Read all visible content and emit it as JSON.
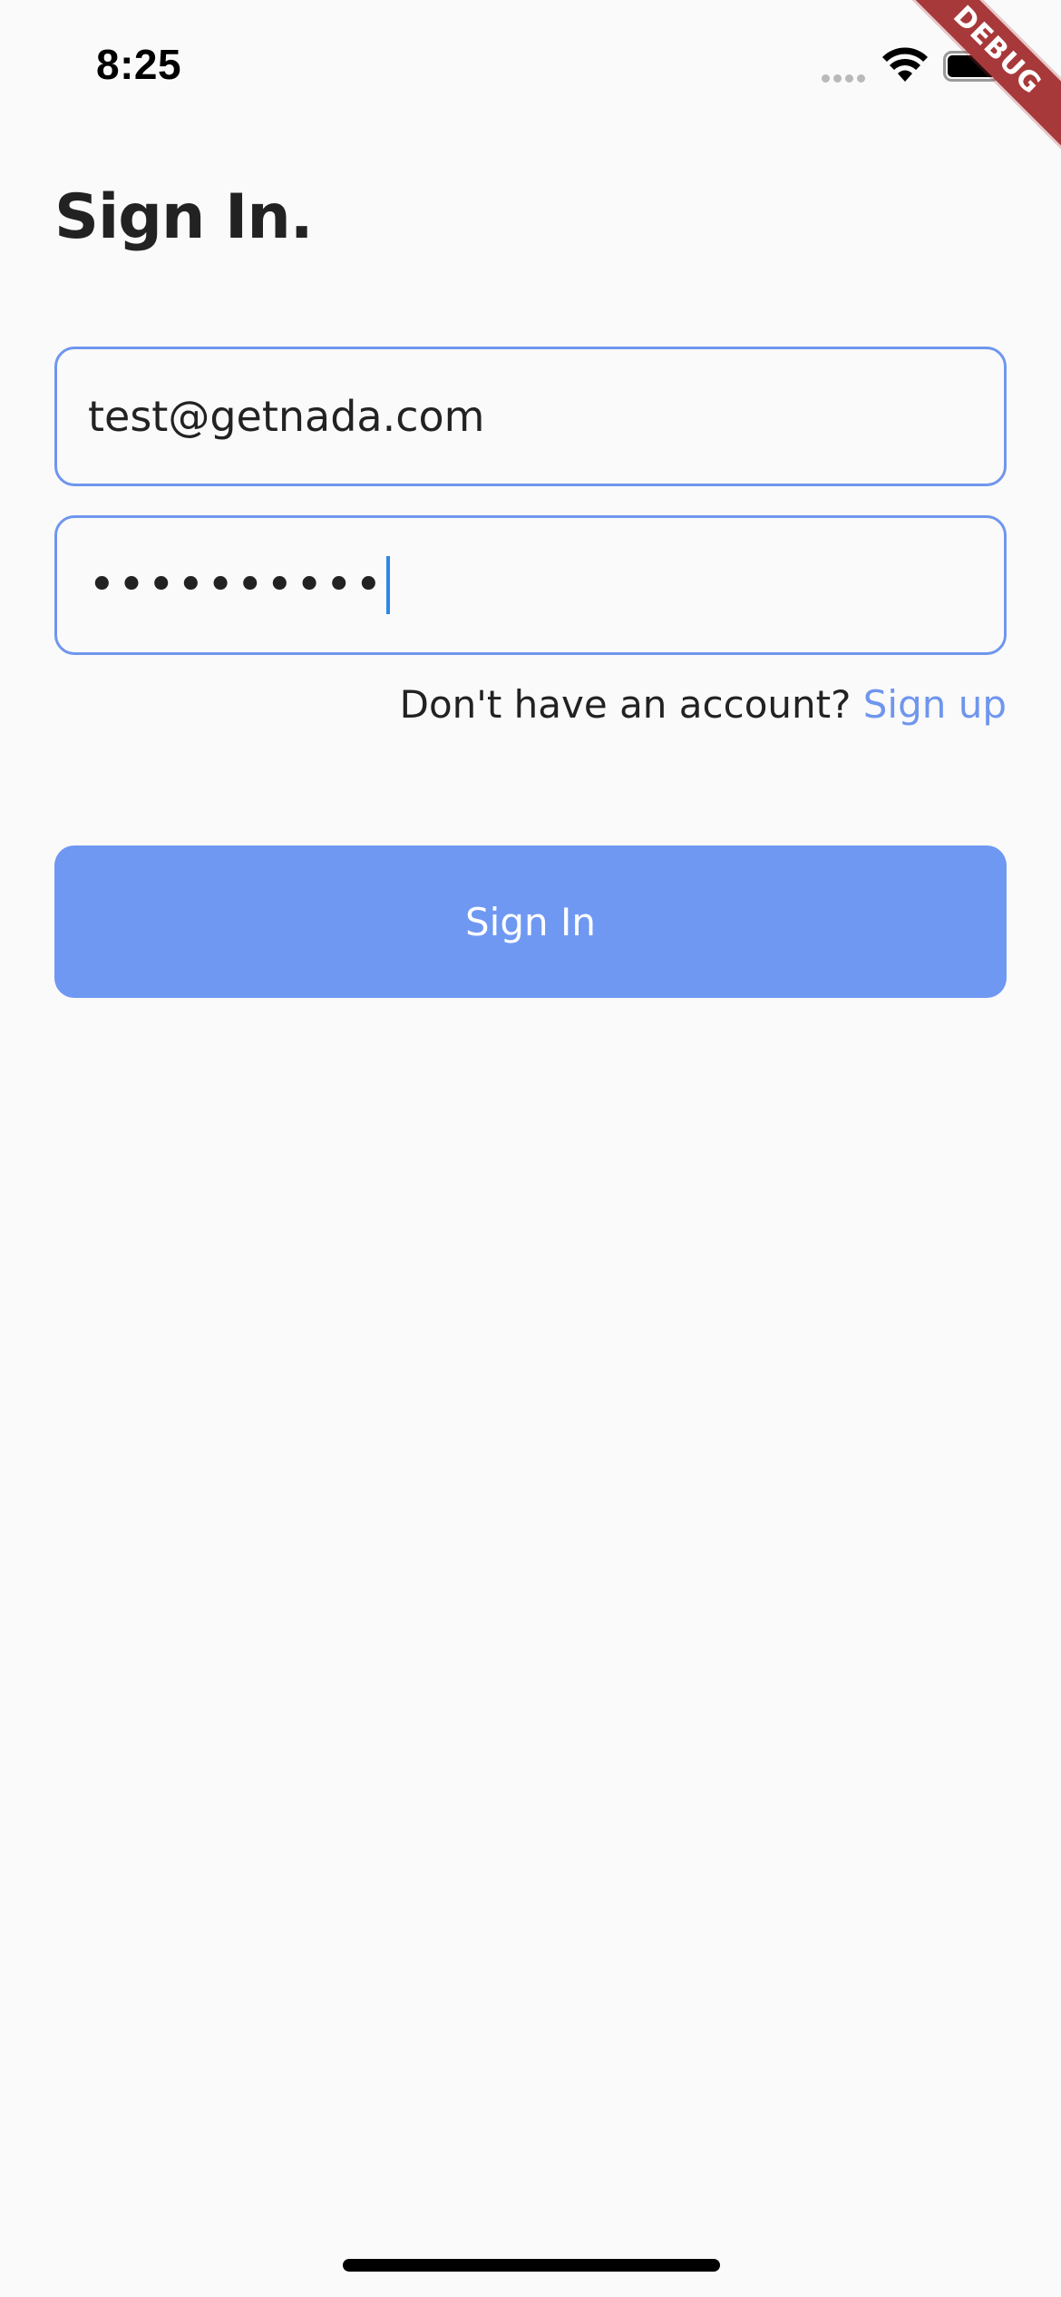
{
  "status_bar": {
    "time": "8:25"
  },
  "debug_ribbon": {
    "label": "DEBUG"
  },
  "page": {
    "title": "Sign In."
  },
  "form": {
    "email": {
      "value": "test@getnada.com",
      "placeholder": ""
    },
    "password": {
      "masked_value": "••••••••••"
    }
  },
  "signup": {
    "prompt": "Don't have an account?",
    "link_label": "Sign up"
  },
  "actions": {
    "signin_label": "Sign In"
  },
  "colors": {
    "accent": "#6f96ee",
    "button_bg": "#6f98f2",
    "background": "#fafafa",
    "text": "#222222",
    "caret": "#2f87e6",
    "debug_ribbon": "#a8393a"
  },
  "icons": {
    "signal": "signal-dots-icon",
    "wifi": "wifi-icon",
    "battery": "battery-icon"
  }
}
